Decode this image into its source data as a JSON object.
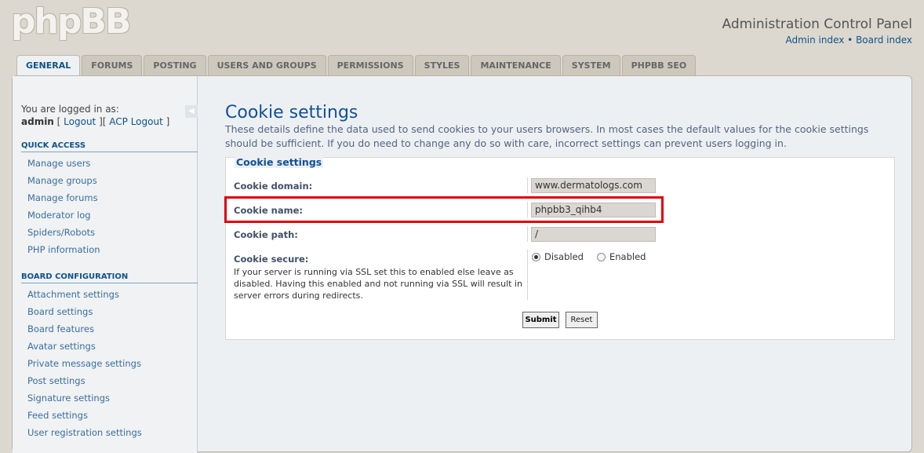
{
  "logo_text": "phpBB",
  "header": {
    "title": "Administration Control Panel",
    "admin_index": "Admin index",
    "separator": " • ",
    "board_index": "Board index"
  },
  "tabs": [
    {
      "label": "GENERAL",
      "active": true
    },
    {
      "label": "FORUMS"
    },
    {
      "label": "POSTING"
    },
    {
      "label": "USERS AND GROUPS"
    },
    {
      "label": "PERMISSIONS"
    },
    {
      "label": "STYLES"
    },
    {
      "label": "MAINTENANCE"
    },
    {
      "label": "SYSTEM"
    },
    {
      "label": "PHPBB SEO"
    }
  ],
  "sidebar": {
    "logged_in_as": "You are logged in as:",
    "username": "admin",
    "bracket_open": " [ ",
    "logout": "Logout",
    "bracket_mid": " ][ ",
    "acp_logout": "ACP Logout",
    "bracket_close": " ]",
    "collapse_icon": "◀",
    "quick_access": {
      "heading": "QUICK ACCESS",
      "items": [
        "Manage users",
        "Manage groups",
        "Manage forums",
        "Moderator log",
        "Spiders/Robots",
        "PHP information"
      ]
    },
    "board_configuration": {
      "heading": "BOARD CONFIGURATION",
      "items": [
        "Attachment settings",
        "Board settings",
        "Board features",
        "Avatar settings",
        "Private message settings",
        "Post settings",
        "Signature settings",
        "Feed settings",
        "User registration settings"
      ]
    }
  },
  "main": {
    "title": "Cookie settings",
    "intro": "These details define the data used to send cookies to your users browsers. In most cases the default values for the cookie settings should be sufficient. If you do need to change any do so with care, incorrect settings can prevent users logging in.",
    "legend": "Cookie settings",
    "cookie_domain": {
      "label": "Cookie domain:",
      "value": "www.dermatologs.com"
    },
    "cookie_name": {
      "label": "Cookie name:",
      "value": "phpbb3_qihb4"
    },
    "cookie_path": {
      "label": "Cookie path:",
      "value": "/"
    },
    "cookie_secure": {
      "label": "Cookie secure:",
      "explain": "If your server is running via SSL set this to enabled else leave as disabled. Having this enabled and not running via SSL will result in server errors during redirects.",
      "option_disabled": "Disabled",
      "option_enabled": "Enabled",
      "selected": "Disabled"
    },
    "submit": "Submit",
    "reset": "Reset"
  }
}
